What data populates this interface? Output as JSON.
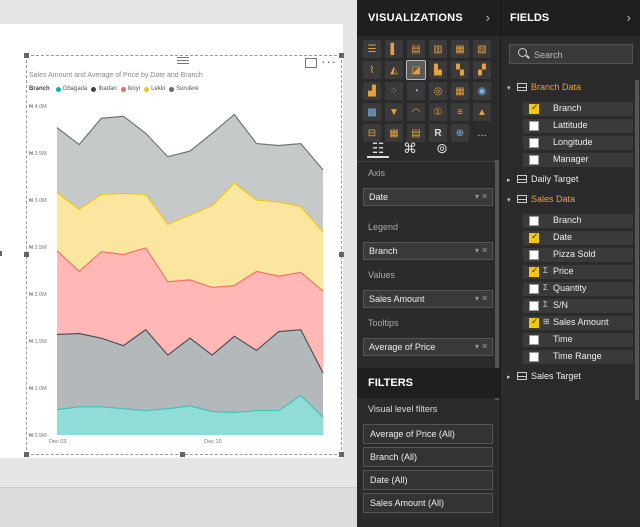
{
  "visual": {
    "title": "Sales Amount and Average of Price by Date and Branch",
    "legend_title": "Branch",
    "legend": [
      {
        "name": "Gbagada",
        "color": "#01b8aa"
      },
      {
        "name": "Ibadan",
        "color": "#374649"
      },
      {
        "name": "Ikoyi",
        "color": "#fd625e"
      },
      {
        "name": "Lekki",
        "color": "#f2c80f"
      },
      {
        "name": "Surulere",
        "color": "#5f6b6d"
      }
    ]
  },
  "chart_data": {
    "type": "area",
    "stacked": true,
    "title": "Sales Amount and Average of Price by Date and Branch",
    "xlabel": "",
    "ylabel": "",
    "x_tick_labels": [
      "Dec 03",
      "Dec 10"
    ],
    "y_tick_labels": [
      "₦ 0.5M",
      "₦ 1.0M",
      "₦ 1.5M",
      "₦ 2.0M",
      "₦ 2.5M",
      "₦ 3.0M",
      "₦ 3.5M",
      "₦ 4.0M"
    ],
    "ylim": [
      0.5,
      4.0
    ],
    "x": [
      "Dec 03",
      "Dec 04",
      "Dec 05",
      "Dec 06",
      "Dec 07",
      "Dec 08",
      "Dec 09",
      "Dec 10",
      "Dec 11",
      "Dec 12",
      "Dec 13",
      "Dec 14",
      "Dec 15"
    ],
    "cumulative_tops": [
      {
        "name": "Gbagada",
        "values": [
          0.77,
          0.8,
          0.8,
          0.78,
          0.76,
          0.78,
          0.81,
          0.75,
          0.74,
          0.76,
          0.76,
          0.92,
          0.69
        ]
      },
      {
        "name": "Ibadan",
        "values": [
          1.57,
          1.58,
          1.53,
          1.45,
          1.62,
          1.35,
          1.53,
          1.35,
          1.55,
          1.4,
          1.6,
          1.62,
          1.16
        ]
      },
      {
        "name": "Ikoyi",
        "values": [
          2.46,
          2.24,
          2.45,
          2.42,
          2.49,
          2.13,
          2.15,
          2.07,
          2.09,
          2.24,
          2.19,
          2.23,
          2.03
        ]
      },
      {
        "name": "Lekki",
        "values": [
          3.08,
          2.9,
          3.06,
          3.07,
          3.06,
          2.74,
          2.84,
          2.94,
          3.18,
          3.0,
          2.98,
          2.93,
          2.66
        ]
      },
      {
        "name": "Surulere",
        "values": [
          3.77,
          3.59,
          3.87,
          3.89,
          3.71,
          3.46,
          3.52,
          3.71,
          3.91,
          3.6,
          3.58,
          3.6,
          3.32
        ]
      }
    ],
    "colors": [
      "#01b8aa",
      "#374649",
      "#fd625e",
      "#f2c80f",
      "#5f6b6d"
    ],
    "grid": false,
    "legend_position": "top-left"
  },
  "viz": {
    "title": "VISUALIZATIONS",
    "icons": [
      "stacked-bar-icon",
      "stacked-column-icon",
      "clustered-bar-icon",
      "clustered-column-icon",
      "100-bar-icon",
      "100-column-icon",
      "line-chart-icon",
      "area-chart-icon",
      "stacked-area-chart-icon",
      "line-column-icon",
      "line-clustered-column-icon",
      "ribbon-chart-icon",
      "waterfall-icon",
      "scatter-icon",
      "pie-icon",
      "donut-icon",
      "treemap-icon",
      "map-icon",
      "filled-map-icon",
      "funnel-icon",
      "gauge-icon",
      "card-icon",
      "multi-row-card-icon",
      "kpi-icon",
      "slicer-icon",
      "table-icon",
      "matrix-icon",
      "r-visual-icon",
      "globe-icon",
      "more-icon"
    ],
    "icon_glyphs": [
      "☰",
      "▌",
      "▤",
      "▥",
      "▦",
      "▧",
      "⌇",
      "◭",
      "◪",
      "▙",
      "▚",
      "▞",
      "▟",
      "⁘",
      "◔",
      "◎",
      "▦",
      "◉",
      "▩",
      "▼",
      "◠",
      "①",
      "≡",
      "▲",
      "⊟",
      "▦",
      "▤",
      "R",
      "⊕",
      "…"
    ],
    "tabs": [
      "fields-tab-icon",
      "format-tab-icon",
      "analytics-tab-icon"
    ],
    "wells": [
      {
        "label": "Axis",
        "value": "Date"
      },
      {
        "label": "Legend",
        "value": "Branch"
      },
      {
        "label": "Values",
        "value": "Sales Amount"
      },
      {
        "label": "Tooltips",
        "value": "Average of Price"
      }
    ]
  },
  "filters": {
    "title": "FILTERS",
    "subtitle": "Visual level filters",
    "items": [
      "Average of Price  (All)",
      "Branch  (All)",
      "Date  (All)",
      "Sales Amount  (All)"
    ]
  },
  "fields": {
    "title": "FIELDS",
    "search_placeholder": "Search",
    "tables": [
      {
        "name": "Branch Data",
        "open": true,
        "items": [
          {
            "name": "Branch",
            "checked": true,
            "sigma": ""
          },
          {
            "name": "Lattitude",
            "checked": false,
            "sigma": ""
          },
          {
            "name": "Longitude",
            "checked": false,
            "sigma": ""
          },
          {
            "name": "Manager",
            "checked": false,
            "sigma": ""
          }
        ]
      },
      {
        "name": "Daily Target",
        "open": false,
        "items": []
      },
      {
        "name": "Sales Data",
        "open": true,
        "items": [
          {
            "name": "Branch",
            "checked": false,
            "sigma": ""
          },
          {
            "name": "Date",
            "checked": true,
            "sigma": ""
          },
          {
            "name": "Pizza Sold",
            "checked": false,
            "sigma": ""
          },
          {
            "name": "Price",
            "checked": true,
            "sigma": "Σ"
          },
          {
            "name": "Quantity",
            "checked": false,
            "sigma": "Σ"
          },
          {
            "name": "S/N",
            "checked": false,
            "sigma": "Σ"
          },
          {
            "name": "Sales Amount",
            "checked": true,
            "sigma": "⊞"
          },
          {
            "name": "Time",
            "checked": false,
            "sigma": ""
          },
          {
            "name": "Time Range",
            "checked": false,
            "sigma": ""
          }
        ]
      },
      {
        "name": "Sales Target",
        "open": false,
        "items": []
      }
    ]
  }
}
